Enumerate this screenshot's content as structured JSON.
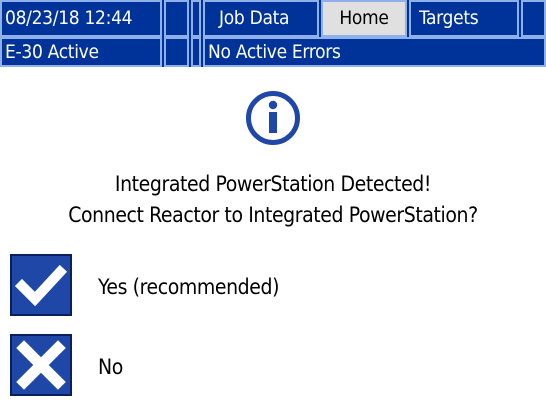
{
  "header": {
    "datetime": "08/23/18 12:44",
    "tabs": [
      {
        "label": "Job Data",
        "selected": false
      },
      {
        "label": "Home",
        "selected": true
      },
      {
        "label": "Targets",
        "selected": false
      }
    ],
    "status": "E-30 Active",
    "errors": "No Active Errors"
  },
  "dialog": {
    "icon": "info-icon",
    "message_line1": "Integrated PowerStation Detected!",
    "message_line2": "Connect Reactor to Integrated PowerStation?"
  },
  "options": {
    "yes": {
      "icon": "checkmark-icon",
      "label": "Yes (recommended)"
    },
    "no": {
      "icon": "x-icon",
      "label": "No"
    }
  },
  "colors": {
    "header_blue": "#003399",
    "button_blue": "#1f47a8",
    "selected_tab": "#e0e0e0",
    "cell_border": "#8fb0e8"
  }
}
